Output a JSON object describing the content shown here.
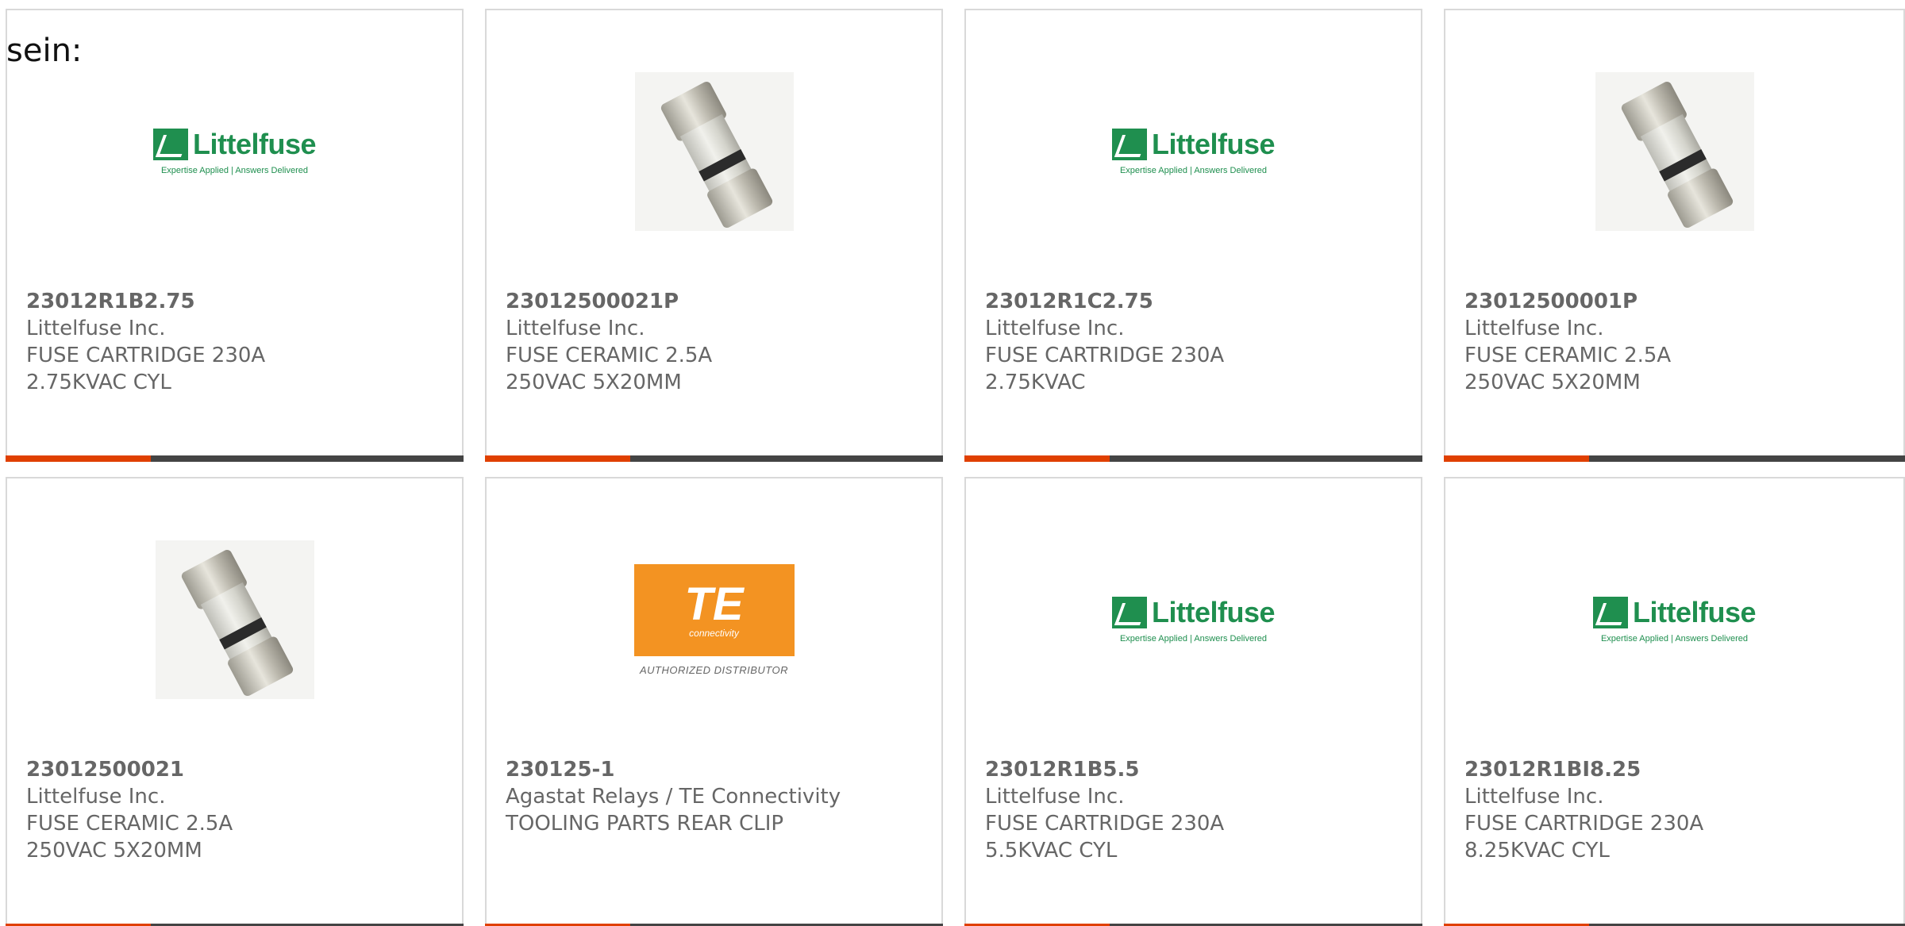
{
  "intro_text": "sein:",
  "colors": {
    "accent": "#e04000",
    "bar": "#444444",
    "text": "#666666",
    "littelfuse_green": "#1f8f4f",
    "te_orange": "#f39322"
  },
  "logos": {
    "littelfuse": {
      "name": "Littelfuse",
      "tagline": "Expertise Applied | Answers Delivered"
    },
    "te": {
      "name": "TE",
      "sub": "connectivity",
      "authorized": "AUTHORIZED DISTRIBUTOR"
    }
  },
  "products": [
    {
      "part_number": "23012R1B2.75",
      "manufacturer": "Littelfuse Inc.",
      "description": "FUSE CARTRIDGE 230A 2.75KVAC CYL",
      "image": "littelfuse-logo"
    },
    {
      "part_number": "23012500021P",
      "manufacturer": "Littelfuse Inc.",
      "description": "FUSE CERAMIC 2.5A 250VAC 5X20MM",
      "image": "fuse-photo"
    },
    {
      "part_number": "23012R1C2.75",
      "manufacturer": "Littelfuse Inc.",
      "description": "FUSE CARTRIDGE 230A 2.75KVAC",
      "image": "littelfuse-logo"
    },
    {
      "part_number": "23012500001P",
      "manufacturer": "Littelfuse Inc.",
      "description": "FUSE CERAMIC 2.5A 250VAC 5X20MM",
      "image": "fuse-photo"
    },
    {
      "part_number": "23012500021",
      "manufacturer": "Littelfuse Inc.",
      "description": "FUSE CERAMIC 2.5A 250VAC 5X20MM",
      "image": "fuse-photo"
    },
    {
      "part_number": "230125-1",
      "manufacturer": "Agastat Relays / TE Connectivity",
      "description": "TOOLING PARTS REAR CLIP",
      "image": "te-logo"
    },
    {
      "part_number": "23012R1B5.5",
      "manufacturer": "Littelfuse Inc.",
      "description": "FUSE CARTRIDGE 230A 5.5KVAC CYL",
      "image": "littelfuse-logo"
    },
    {
      "part_number": "23012R1BI8.25",
      "manufacturer": "Littelfuse Inc.",
      "description": "FUSE CARTRIDGE 230A 8.25KVAC CYL",
      "image": "littelfuse-logo"
    }
  ]
}
